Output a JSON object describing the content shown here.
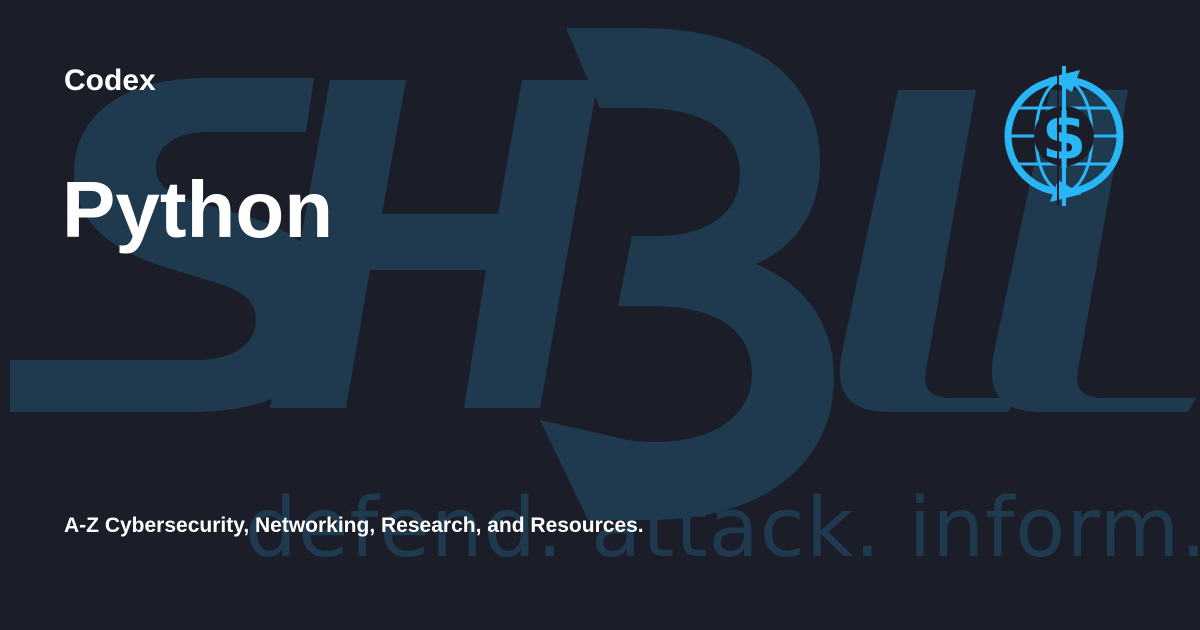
{
  "site": {
    "name": "Codex"
  },
  "page": {
    "title": "Python",
    "description": "A-Z Cybersecurity, Networking, Research, and Resources."
  },
  "watermark": {
    "wordmark": "SH3LL",
    "tagline": "defend. attack. inform."
  },
  "logo": {
    "icon": "shell-dollar-globe-icon",
    "glyph": "$"
  },
  "colors": {
    "background": "#1b1e28",
    "watermark": "#1f3a4e",
    "accent": "#29b6f6",
    "text": "#ffffff"
  }
}
